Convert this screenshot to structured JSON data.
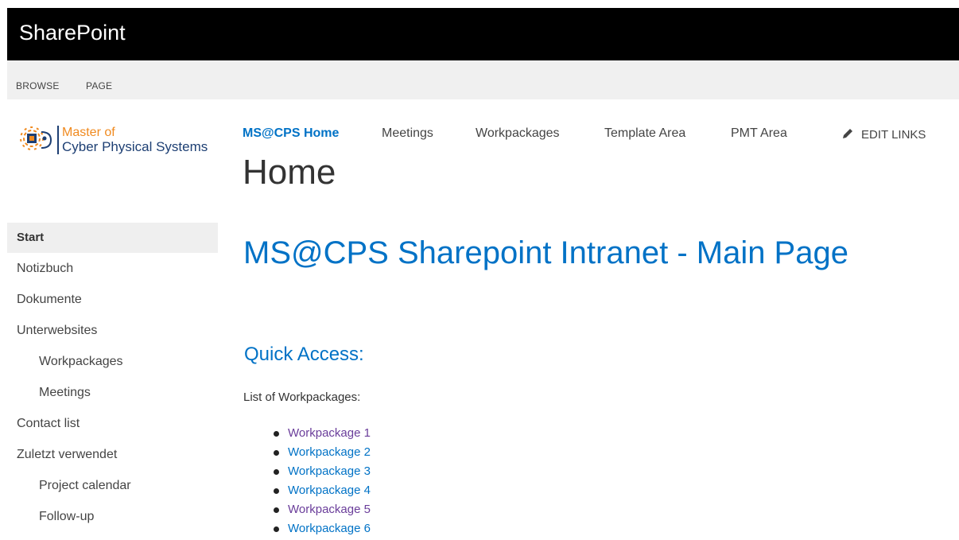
{
  "suite_bar": {
    "brand": "SharePoint"
  },
  "ribbon": {
    "tabs": [
      "BROWSE",
      "PAGE"
    ]
  },
  "logo": {
    "line1": "Master of",
    "line2": "Cyber Physical Systems"
  },
  "top_nav": {
    "items": [
      "MS@CPS Home",
      "Meetings",
      "Workpackages",
      "Template Area",
      "PMT Area"
    ],
    "selected": "MS@CPS Home",
    "edit_links": "EDIT LINKS"
  },
  "page_title": "Home",
  "left_nav": {
    "items": [
      {
        "label": "Start",
        "level": 0,
        "selected": true
      },
      {
        "label": "Notizbuch",
        "level": 0
      },
      {
        "label": "Dokumente",
        "level": 0
      },
      {
        "label": "Unterwebsites",
        "level": 0
      },
      {
        "label": "Workpackages",
        "level": 1
      },
      {
        "label": "Meetings",
        "level": 1
      },
      {
        "label": "Contact list",
        "level": 0
      },
      {
        "label": "Zuletzt verwendet",
        "level": 0
      },
      {
        "label": "Project calendar",
        "level": 1
      },
      {
        "label": "Follow-up",
        "level": 1
      }
    ]
  },
  "content": {
    "heading": "MS@CPS Sharepoint Intranet - Main Page",
    "quick_access": "Quick Access:",
    "list_label": "List of Workpackages:",
    "workpackages": [
      {
        "label": "Workpackage 1",
        "visited": true
      },
      {
        "label": "Workpackage 2",
        "visited": false
      },
      {
        "label": "Workpackage 3",
        "visited": false
      },
      {
        "label": "Workpackage 4",
        "visited": false
      },
      {
        "label": "Workpackage 5",
        "visited": true
      },
      {
        "label": "Workpackage 6",
        "visited": false
      }
    ]
  },
  "colors": {
    "accent": "#0072c6",
    "visited_link": "#6a3d9a",
    "suite_bar": "#000000",
    "ribbon": "#f0f0f0",
    "logo_orange": "#f08a1f",
    "logo_navy": "#1d3f73"
  },
  "icons": {
    "edit": "pencil-icon",
    "logo": "gear-chip-logo"
  }
}
